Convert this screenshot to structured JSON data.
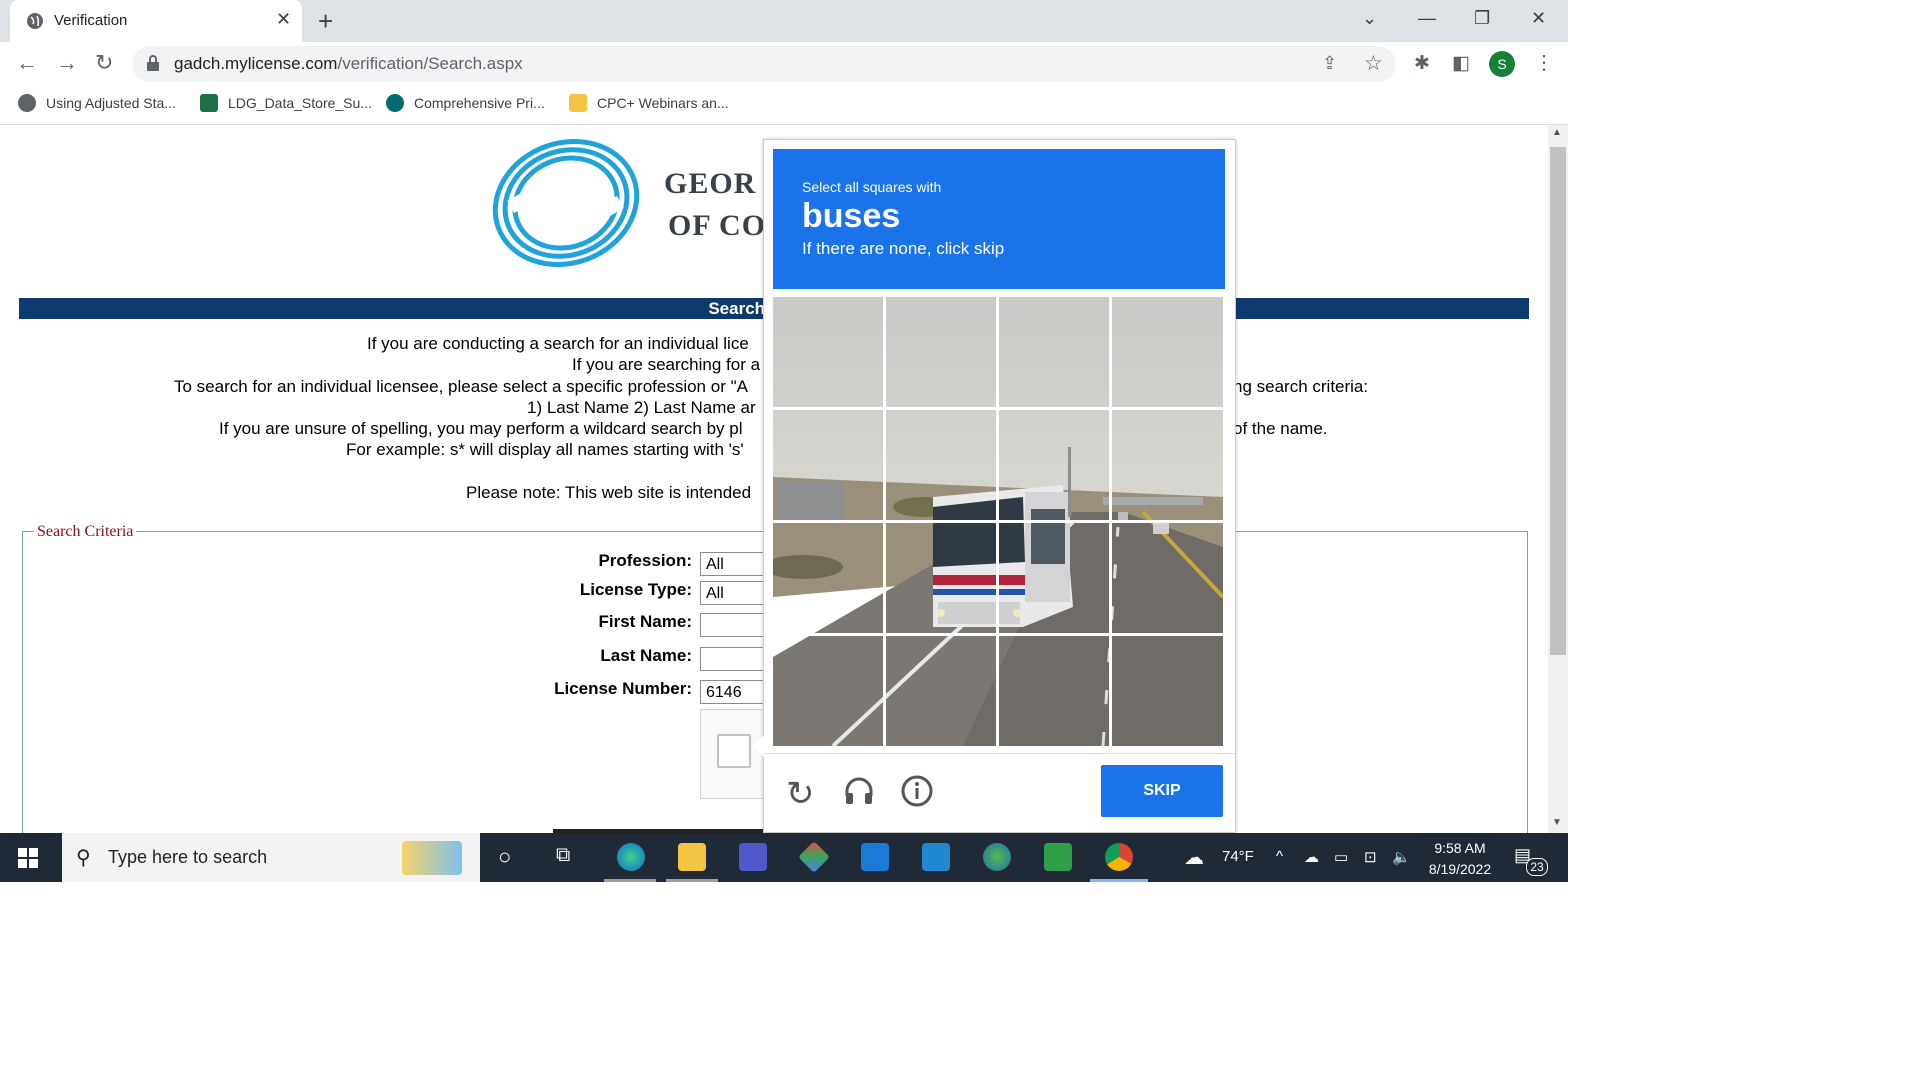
{
  "browser": {
    "tab_title": "Verification",
    "url_host": "gadch.mylicense.com",
    "url_path": "/verification/Search.aspx",
    "profile_initial": "S",
    "bookmarks": [
      {
        "label": "Using Adjusted Sta...",
        "color": "#5f6368"
      },
      {
        "label": "LDG_Data_Store_Su...",
        "color": "#1e7145"
      },
      {
        "label": "Comprehensive Pri...",
        "color": "#036c70"
      },
      {
        "label": "CPC+ Webinars an...",
        "color": "#f6c343"
      }
    ]
  },
  "page": {
    "logo_line1": "GEOR",
    "logo_line2": "OF CO",
    "banner": "Search for a Pro",
    "intro_lines": [
      "If you are conducting a search for an individual lice",
      "If you are searching for a",
      "To search for an individual licensee, please select a specific profession or \"A",
      "ng search criteria:",
      "1) Last Name 2) Last Name ar",
      "If you are unsure of spelling, you may perform a wildcard search by pl",
      "of the name.",
      "For example: s* will display all names starting with 's'",
      "Please note: This web site is intended"
    ],
    "search_criteria_legend": "Search Criteria",
    "form": {
      "profession_label": "Profession:",
      "profession_value": "All",
      "license_type_label": "License Type:",
      "license_type_value": "All",
      "first_name_label": "First Name:",
      "first_name_value": "",
      "last_name_label": "Last Name:",
      "last_name_value": "",
      "license_number_label": "License Number:",
      "license_number_value": "6146"
    }
  },
  "captcha": {
    "instruction_line1": "Select all squares with",
    "target": "buses",
    "instruction_line3": "If there are none, click skip",
    "skip_label": "SKIP",
    "accent_color": "#1a73e8"
  },
  "taskbar": {
    "search_placeholder": "Type here to search",
    "weather": "74°F",
    "time": "9:58 AM",
    "date": "8/19/2022",
    "notification_count": "23"
  }
}
